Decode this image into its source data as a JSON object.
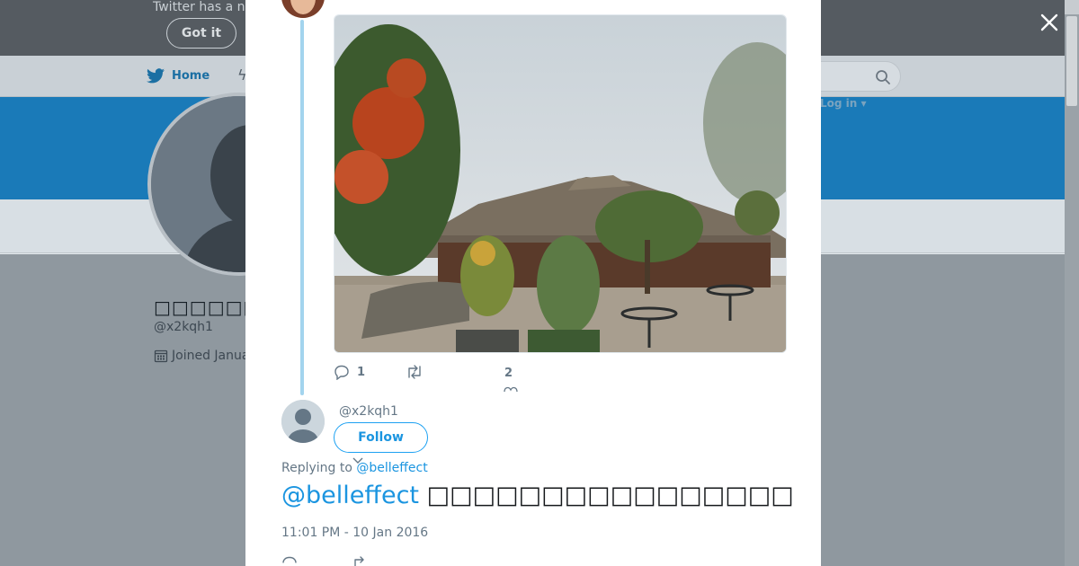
{
  "banner": {
    "text": "Twitter has a n",
    "got_it_label": "Got it"
  },
  "navbar": {
    "home_label": "Home",
    "login_label": "Log in ▾"
  },
  "profile": {
    "name": "□□□□□□",
    "handle": "@x2kqh1",
    "joined": "Joined Janua"
  },
  "modal": {
    "actions": {
      "reply_count": "1",
      "like_count": "2"
    },
    "reply": {
      "handle": "@x2kqh1",
      "follow_label": "Follow",
      "replying_prefix": "Replying to",
      "replying_mention": "@belleffect",
      "text_mention": "@belleffect",
      "text_body": "□□□□□□□□□□□□□□□□",
      "timestamp": "11:01 PM - 10 Jan 2016"
    }
  },
  "colors": {
    "brand": "#1da1f2",
    "link": "#1b95e0",
    "cover": "#1a7ab8",
    "overlay": "#8f989f",
    "thread_line": "#a3d4ee"
  },
  "icons": {
    "close": "close-icon",
    "reply": "reply-icon",
    "retweet": "retweet-icon",
    "like": "heart-icon",
    "search": "search-icon",
    "calendar": "calendar-icon",
    "twitter": "twitter-bird-icon"
  }
}
